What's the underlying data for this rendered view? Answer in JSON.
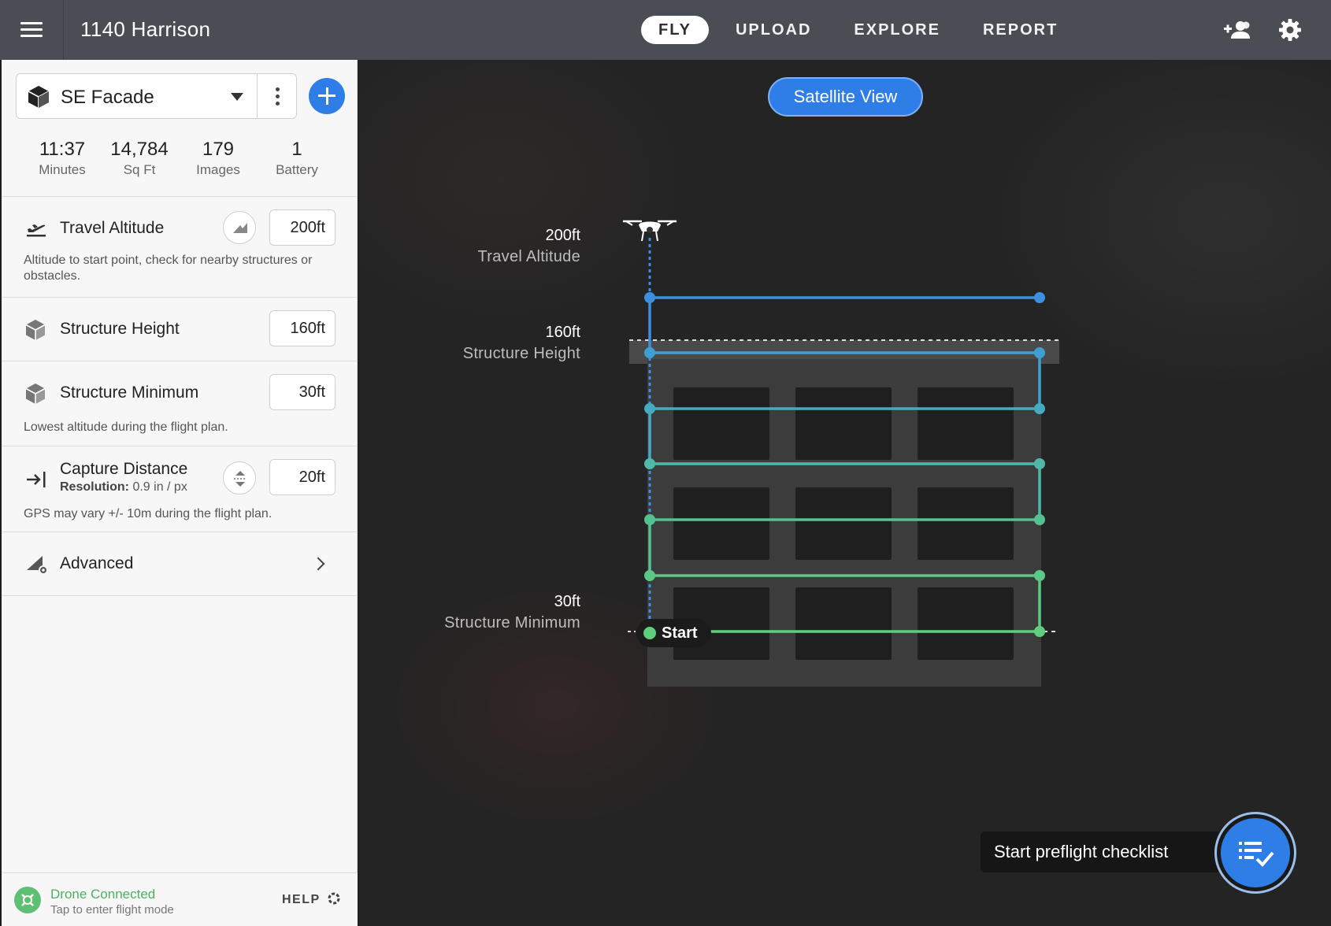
{
  "header": {
    "title": "1140 Harrison",
    "tabs": [
      {
        "label": "FLY",
        "active": true
      },
      {
        "label": "UPLOAD",
        "active": false
      },
      {
        "label": "EXPLORE",
        "active": false
      },
      {
        "label": "REPORT",
        "active": false
      }
    ],
    "icons": [
      "menu-icon",
      "add-person-icon",
      "gear-icon"
    ]
  },
  "sidebar": {
    "plan": {
      "name": "SE Facade",
      "icon": "cube-icon"
    },
    "stats": [
      {
        "value": "11:37",
        "label": "Minutes"
      },
      {
        "value": "14,784",
        "label": "Sq Ft"
      },
      {
        "value": "179",
        "label": "Images"
      },
      {
        "value": "1",
        "label": "Battery"
      }
    ],
    "travel_altitude": {
      "label": "Travel Altitude",
      "value": "200ft",
      "help": "Altitude to start point, check for nearby structures or obstacles."
    },
    "structure_height": {
      "label": "Structure Height",
      "value": "160ft"
    },
    "structure_minimum": {
      "label": "Structure Minimum",
      "value": "30ft",
      "help": "Lowest altitude during the flight plan."
    },
    "capture_distance": {
      "label": "Capture Distance",
      "resolution_label": "Resolution:",
      "resolution_value": "0.9 in / px",
      "value": "20ft",
      "help": "GPS may vary +/- 10m during the flight plan."
    },
    "advanced": {
      "label": "Advanced"
    },
    "status": {
      "title": "Drone Connected",
      "subtitle": "Tap to enter flight mode",
      "help_label": "HELP"
    }
  },
  "map": {
    "view_button": "Satellite View",
    "labels": {
      "travel": {
        "value": "200ft",
        "name": "Travel Altitude"
      },
      "height": {
        "value": "160ft",
        "name": "Structure Height"
      },
      "minimum": {
        "value": "30ft",
        "name": "Structure Minimum"
      }
    },
    "start_label": "Start",
    "checklist_label": "Start preflight checklist",
    "colors": {
      "accent": "#2f7ee8",
      "path_top": "#3d8fe0",
      "path_mid": "#3fa7c9",
      "path_bottom": "#5fcf7e",
      "drone_connected": "#4caf64"
    }
  }
}
